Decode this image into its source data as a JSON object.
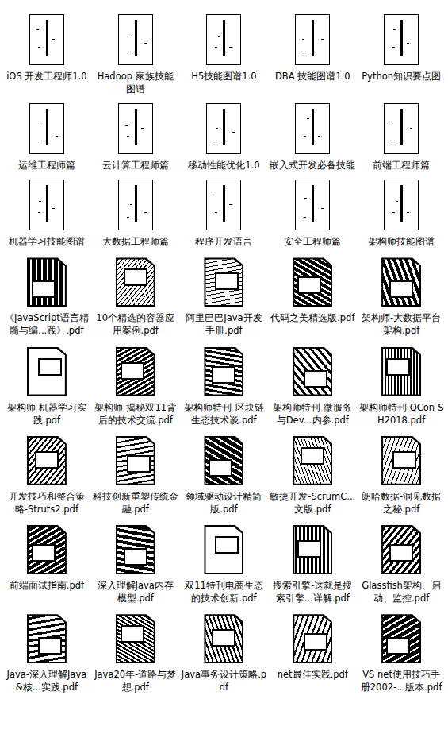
{
  "files": [
    {
      "name": "iOS 开发工程师1.0",
      "kind": "mindmap"
    },
    {
      "name": "Hadoop 家族技能图谱",
      "kind": "mindmap"
    },
    {
      "name": "H5技能图谱1.0",
      "kind": "mindmap"
    },
    {
      "name": "DBA 技能图谱1.0",
      "kind": "mindmap"
    },
    {
      "name": "Python知识要点图",
      "kind": "mindmap"
    },
    {
      "name": "运维工程师篇",
      "kind": "mindmap"
    },
    {
      "name": "云计算工程师篇",
      "kind": "mindmap"
    },
    {
      "name": "移动性能优化1.0",
      "kind": "mindmap"
    },
    {
      "name": "嵌入式开发必备技能",
      "kind": "mindmap"
    },
    {
      "name": "前端工程师篇",
      "kind": "mindmap"
    },
    {
      "name": "机器学习技能图谱",
      "kind": "mindmap"
    },
    {
      "name": "大数据工程师篇",
      "kind": "mindmap"
    },
    {
      "name": "程序开发语言",
      "kind": "mindmap"
    },
    {
      "name": "安全工程师篇",
      "kind": "mindmap"
    },
    {
      "name": "架构师技能图谱",
      "kind": "mindmap"
    },
    {
      "name": "《JavaScript语言精髓与编...践》.pdf",
      "kind": "pdf"
    },
    {
      "name": "10个精选的容器应用案例.pdf",
      "kind": "pdf"
    },
    {
      "name": "阿里巴巴Java开发手册.pdf",
      "kind": "pdf"
    },
    {
      "name": "代码之美精选版.pdf",
      "kind": "pdf"
    },
    {
      "name": "架构师-大数据平台架构.pdf",
      "kind": "pdf"
    },
    {
      "name": "架构师-机器学习实践.pdf",
      "kind": "pdf"
    },
    {
      "name": "架构师-揭秘双11背后的技术交流.pdf",
      "kind": "pdf"
    },
    {
      "name": "架构师特刊-区块链生态技术谈.pdf",
      "kind": "pdf"
    },
    {
      "name": "架构师特刊-微服务与Dev...内参.pdf",
      "kind": "pdf"
    },
    {
      "name": "架构师特刊-QCon-SH2018.pdf",
      "kind": "pdf"
    },
    {
      "name": "开发技巧和整合策略-Struts2.pdf",
      "kind": "pdf"
    },
    {
      "name": "科技创新重塑传统金融.pdf",
      "kind": "pdf"
    },
    {
      "name": "领域驱动设计精简版.pdf",
      "kind": "pdf"
    },
    {
      "name": "敏捷开发-ScrumC...文版.pdf",
      "kind": "pdf"
    },
    {
      "name": "朗哈数据-洞见数据之秘.pdf",
      "kind": "pdf"
    },
    {
      "name": "前端面试指南.pdf",
      "kind": "pdf"
    },
    {
      "name": "深入理解Java内存模型.pdf",
      "kind": "pdf"
    },
    {
      "name": "双11特刊电商生态的技术创新.pdf",
      "kind": "pdf"
    },
    {
      "name": "搜索引擎-这就是搜索引擎...详解.pdf",
      "kind": "pdf"
    },
    {
      "name": "Glassfish架构、启动、监控.pdf",
      "kind": "pdf"
    },
    {
      "name": "Java-深入理解Java&核...实践.pdf",
      "kind": "pdf"
    },
    {
      "name": "Java20年-道路与梦想.pdf",
      "kind": "pdf"
    },
    {
      "name": "Java事务设计策略.pdf",
      "kind": "pdf"
    },
    {
      "name": "net最佳实践.pdf",
      "kind": "pdf"
    },
    {
      "name": "VS net使用技巧手册2002-...版本.pdf",
      "kind": "pdf"
    }
  ]
}
